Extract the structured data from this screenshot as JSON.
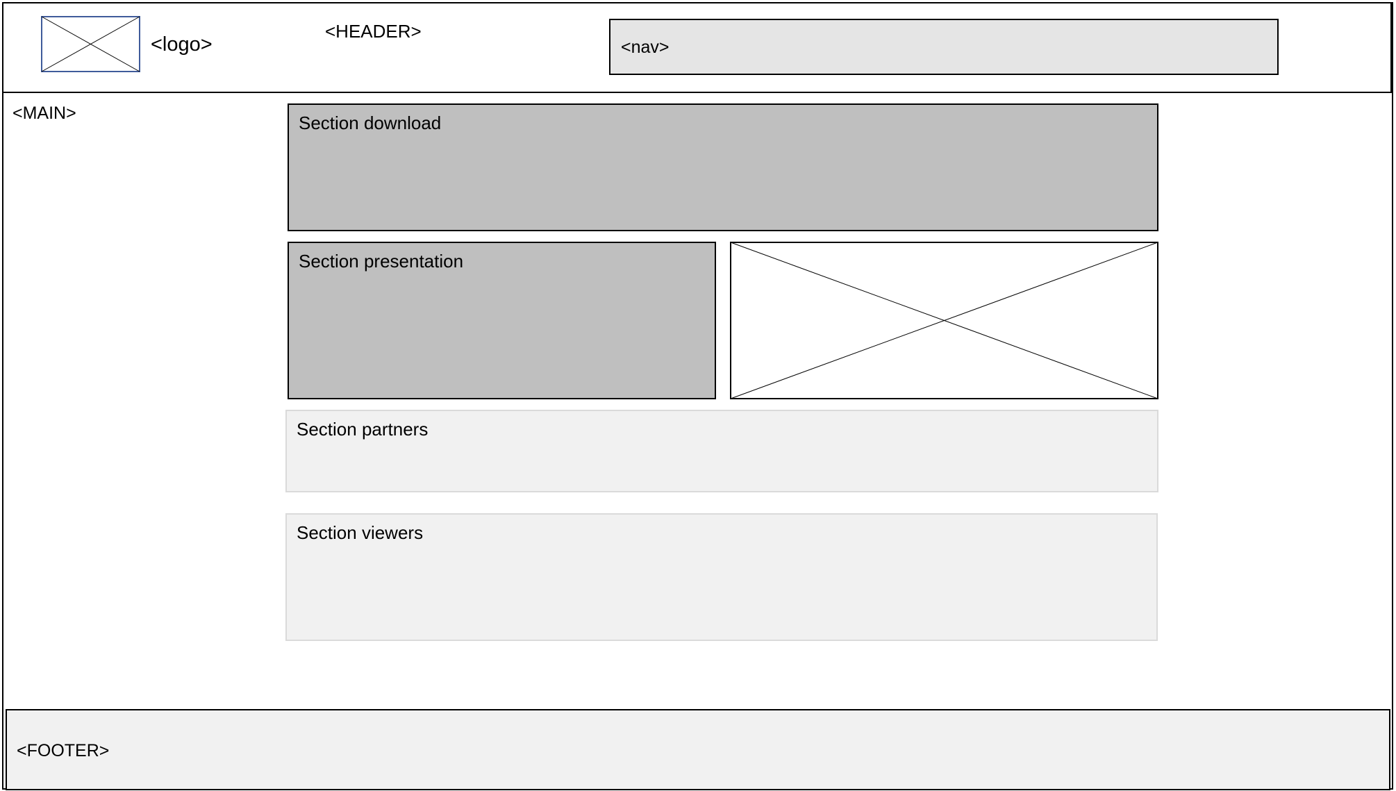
{
  "header": {
    "label": "<HEADER>",
    "logo_label": "<logo>",
    "nav_label": "<nav>"
  },
  "main": {
    "label": "<MAIN>",
    "sections": {
      "download": "Section download",
      "presentation": "Section presentation",
      "partners": "Section partners",
      "viewers": "Section viewers"
    }
  },
  "footer": {
    "label": "<FOOTER>"
  },
  "colors": {
    "dark_section_fill": "#bfbfbf",
    "light_section_fill": "#f1f1f1",
    "nav_fill": "#e5e5e5",
    "logo_border": "#3f5b9a"
  },
  "icons": {
    "logo_placeholder": "image-placeholder-icon",
    "presentation_image": "image-placeholder-icon"
  }
}
